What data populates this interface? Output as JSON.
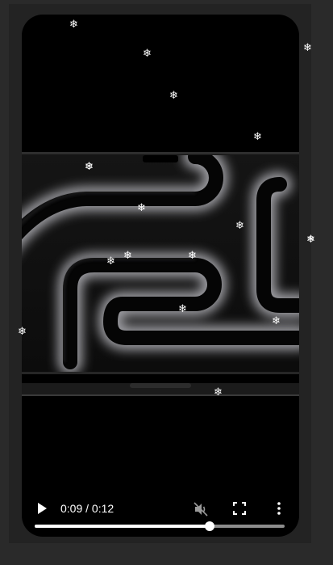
{
  "video": {
    "time_display": "0:09 / 0:12",
    "progress_fraction": 0.7,
    "play_icon": "play-icon",
    "volume_icon": "volume-muted-icon",
    "fullscreen_icon": "fullscreen-icon",
    "more_icon": "more-vertical-icon"
  },
  "colors": {
    "page_background": "#2a2a2a",
    "video_background": "#000000",
    "controls_foreground": "#ffffff",
    "snowflake": "#ffffff"
  },
  "snowflakes": {
    "glyph": "❄",
    "count": 18
  }
}
